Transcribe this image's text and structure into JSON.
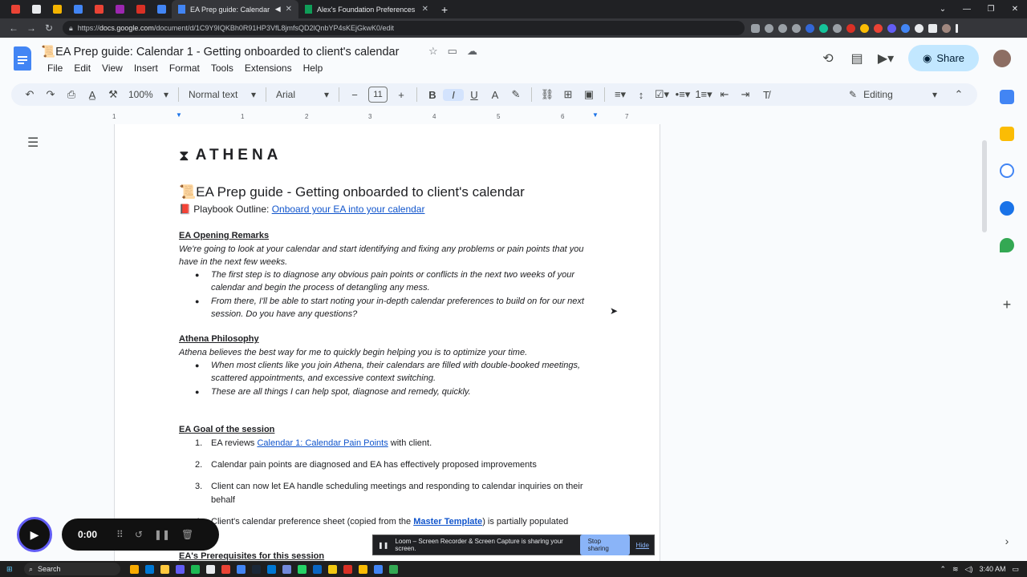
{
  "browser": {
    "tabs": [
      {
        "title": "EA Prep guide: Calendar",
        "active": true
      },
      {
        "title": "Alex's Foundation Preferences - ",
        "active": false
      }
    ],
    "url_host": "docs.google.com",
    "url_path": "/document/d/1C9Y9IQKBh0R91HP3VfL8jmfsQD2lQnbYP4sKEjGkwK0/edit",
    "url_prefix": "https://"
  },
  "docs": {
    "title_icon": "📜",
    "title": "EA Prep guide: Calendar 1 - Getting onboarded to client's calendar",
    "menus": [
      "File",
      "Edit",
      "View",
      "Insert",
      "Format",
      "Tools",
      "Extensions",
      "Help"
    ],
    "share_label": "Share",
    "zoom": "100%",
    "style": "Normal text",
    "font": "Arial",
    "font_size": "11",
    "mode": "Editing"
  },
  "ruler": [
    "1",
    "1",
    "2",
    "3",
    "4",
    "5",
    "6",
    "7"
  ],
  "content": {
    "logo_text": "ATHENA",
    "heading_icon": "📜",
    "heading": "EA Prep guide - Getting onboarded to client's calendar",
    "playbook_icon": "📕",
    "playbook_label": "Playbook Outline: ",
    "playbook_link": "Onboard your EA into your calendar",
    "s1_title": "EA Opening Remarks",
    "s1_intro": "We're going to look at your calendar and start identifying and fixing any problems or pain points that you have in the next few weeks.",
    "s1_b1": "The first step is to diagnose any obvious pain points or conflicts in the next two weeks of your calendar and begin the process of detangling any mess.",
    "s1_b2": "From there, I'll be able to start noting your in-depth calendar preferences to build on for our next session. Do you have any questions?",
    "s2_title": "Athena Philosophy",
    "s2_intro": "Athena believes the best way for me to quickly begin helping you is to optimize your time.",
    "s2_b1": "When most clients like you join Athena, their calendars are filled with double-booked meetings, scattered appointments, and excessive context switching.",
    "s2_b2": "These are all things I can help spot, diagnose and remedy, quickly.",
    "s3_title": "EA Goal of the session",
    "s3_i1_pre": "EA reviews ",
    "s3_i1_link": "Calendar 1: Calendar Pain Points",
    "s3_i1_post": " with client.",
    "s3_i2": "Calendar pain points are diagnosed and EA has effectively proposed improvements",
    "s3_i3": "Client can now let EA handle scheduling meetings and responding to calendar inquiries on their behalf",
    "s3_i4_pre": "Client's calendar preference sheet (copied from the ",
    "s3_i4_link": "Master Template",
    "s3_i4_post": ") is partially populated",
    "s4_title": "EA's Prerequisites for this session"
  },
  "loom": {
    "time": "0:00"
  },
  "sharing_bar": {
    "message": "Loom – Screen Recorder & Screen Capture is sharing your screen.",
    "stop_label": "Stop sharing",
    "hide_label": "Hide"
  },
  "taskbar": {
    "search_label": "Search",
    "time": "3:40 AM"
  },
  "colors": {
    "accent": "#1a73e8",
    "share_bg": "#c2e7ff",
    "link": "#1155cc",
    "loom": "#625df5"
  }
}
